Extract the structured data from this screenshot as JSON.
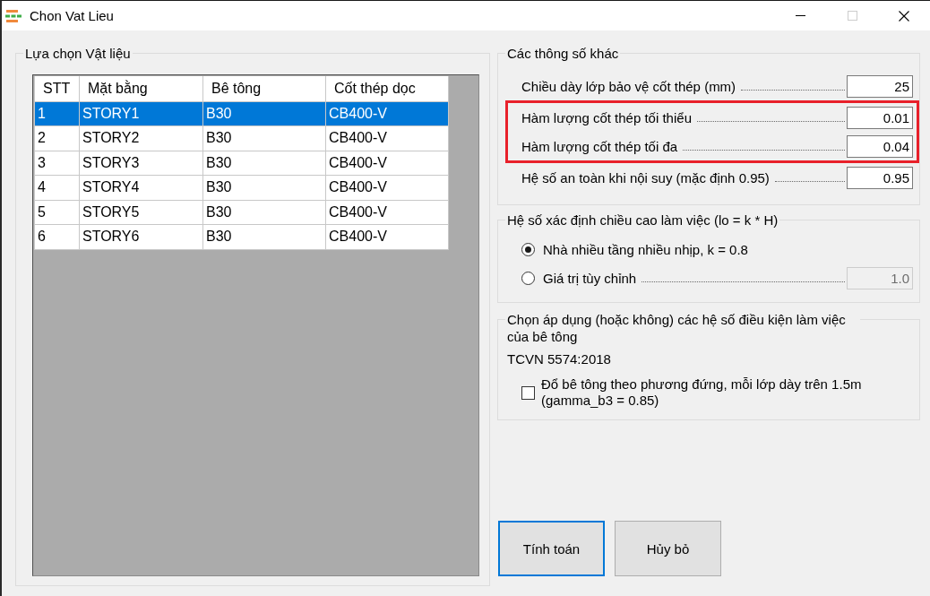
{
  "window": {
    "title": "Chon Vat Lieu",
    "maximize_disabled": true
  },
  "materials": {
    "title": "Lựa chọn Vật liệu",
    "columns": [
      "STT",
      "Mặt bằng",
      "Bê tông",
      "Cốt thép dọc"
    ],
    "rows": [
      {
        "cells": [
          "1",
          "STORY1",
          "B30",
          "CB400-V"
        ],
        "selected": true
      },
      {
        "cells": [
          "2",
          "STORY2",
          "B30",
          "CB400-V"
        ],
        "selected": false
      },
      {
        "cells": [
          "3",
          "STORY3",
          "B30",
          "CB400-V"
        ],
        "selected": false
      },
      {
        "cells": [
          "4",
          "STORY4",
          "B30",
          "CB400-V"
        ],
        "selected": false
      },
      {
        "cells": [
          "5",
          "STORY5",
          "B30",
          "CB400-V"
        ],
        "selected": false
      },
      {
        "cells": [
          "6",
          "STORY6",
          "B30",
          "CB400-V"
        ],
        "selected": false
      }
    ]
  },
  "params": {
    "title": "Các thông số khác",
    "rows": [
      {
        "label": "Chiều dày lớp bảo vệ cốt thép (mm)",
        "value": "25",
        "highlighted": false
      },
      {
        "label": "Hàm lượng cốt thép tối thiểu",
        "value": "0.01",
        "highlighted": true
      },
      {
        "label": "Hàm lượng cốt thép tối đa",
        "value": "0.04",
        "highlighted": true
      },
      {
        "label": "Hệ số an toàn khi nội suy (mặc định 0.95)",
        "value": "0.95",
        "highlighted": false
      }
    ]
  },
  "height_factor": {
    "title": "Hệ số xác định chiều cao làm việc (lo = k * H)",
    "options": [
      {
        "label": "Nhà nhiều tầng nhiều nhịp, k = 0.8",
        "selected": true
      },
      {
        "label": "Giá trị tùy chỉnh",
        "selected": false,
        "value": "1.0",
        "disabled": true
      }
    ]
  },
  "conditions": {
    "title": "Chọn áp dụng (hoặc không) các hệ số điều kiện làm việc của bê tông",
    "standard": "TCVN 5574:2018",
    "checks": [
      {
        "label": "Đổ bê tông theo phương đứng, mỗi lớp dày trên 1.5m (gamma_b3 = 0.85)",
        "checked": false
      }
    ]
  },
  "buttons": [
    {
      "label": "Tính toán",
      "focused": true
    },
    {
      "label": "Hủy bỏ",
      "focused": false
    }
  ]
}
